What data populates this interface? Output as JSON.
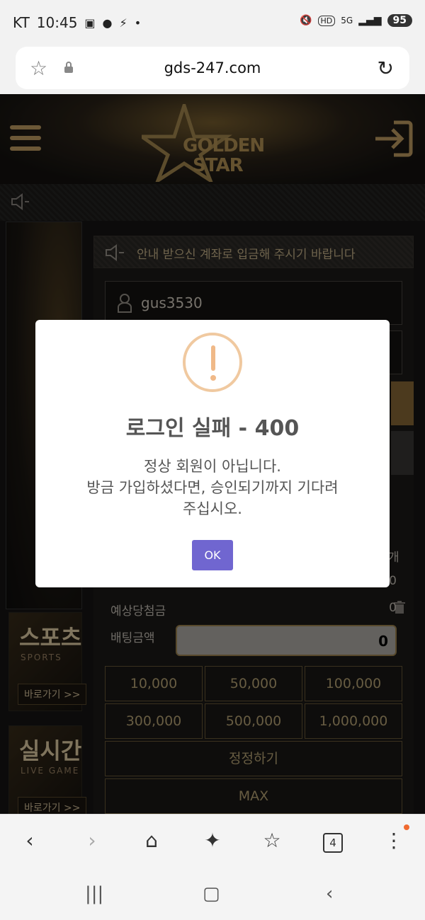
{
  "status": {
    "carrier": "KT",
    "time": "10:45",
    "battery": "95",
    "hd": "HD",
    "net": "5G"
  },
  "browser": {
    "url": "gds-247.com",
    "tab_count": "4"
  },
  "site": {
    "logo_line1": "GOLDEN",
    "logo_line2": "STAR",
    "notice": "안내 받으신 계좌로 입금해 주시기 바랍니다",
    "username": "gus3530",
    "partial_right_label": "개",
    "expected_win_label": "예상당첨금",
    "expected_win_value": "0",
    "bet_amount_label": "배팅금액",
    "bet_amount_value": "0",
    "partial_zero": "0",
    "amounts": [
      "10,000",
      "50,000",
      "100,000",
      "300,000",
      "500,000",
      "1,000,000"
    ],
    "reset_label": "정정하기",
    "max_label": "MAX",
    "promo1": {
      "title": "스포츠",
      "sub": "SPORTS",
      "go": "바로가기 >>"
    },
    "promo2": {
      "title": "실시간",
      "sub": "LIVE GAME",
      "go": "바로가기 >>"
    }
  },
  "modal": {
    "title": "로그인 실패 - 400",
    "line1": "정상 회원이 아닙니다.",
    "line2": "방금 가입하셨다면, 승인되기까지 기다려",
    "line3": "주십시오.",
    "ok": "OK"
  },
  "colors": {
    "accent": "#7066d0",
    "gold": "#c5a164",
    "warn": "#f0b988"
  }
}
